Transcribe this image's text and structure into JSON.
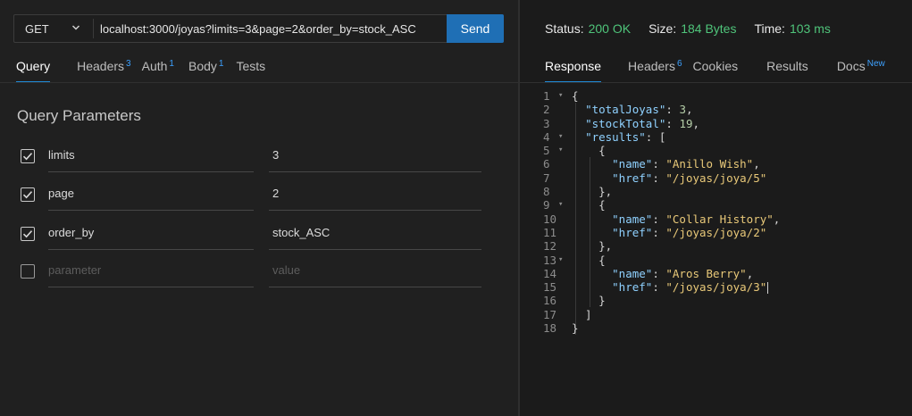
{
  "request": {
    "method": "GET",
    "url": "localhost:3000/joyas?limits=3&page=2&order_by=stock_ASC",
    "send_label": "Send"
  },
  "request_tabs": [
    {
      "label": "Query",
      "badge": ""
    },
    {
      "label": "Headers",
      "badge": "3"
    },
    {
      "label": "Auth",
      "badge": "1"
    },
    {
      "label": "Body",
      "badge": "1"
    },
    {
      "label": "Tests",
      "badge": ""
    }
  ],
  "query": {
    "title": "Query Parameters",
    "params": [
      {
        "key": "limits",
        "value": "3",
        "checked": true
      },
      {
        "key": "page",
        "value": "2",
        "checked": true
      },
      {
        "key": "order_by",
        "value": "stock_ASC",
        "checked": true
      }
    ],
    "new_param": {
      "key_placeholder": "parameter",
      "value_placeholder": "value"
    }
  },
  "status": {
    "status_label": "Status:",
    "status_value": "200 OK",
    "size_label": "Size:",
    "size_value": "184 Bytes",
    "time_label": "Time:",
    "time_value": "103 ms"
  },
  "response_tabs": [
    {
      "label": "Response",
      "badge": ""
    },
    {
      "label": "Headers",
      "badge": "6"
    },
    {
      "label": "Cookies",
      "badge": ""
    },
    {
      "label": "Results",
      "badge": ""
    },
    {
      "label": "Docs",
      "badge": "New"
    }
  ],
  "response_lines": [
    {
      "n": "1",
      "fold": true,
      "tokens": [
        [
          "p",
          "{"
        ]
      ]
    },
    {
      "n": "2",
      "fold": false,
      "tokens": [
        [
          "p",
          "  "
        ],
        [
          "key",
          "\"totalJoyas\""
        ],
        [
          "p",
          ": "
        ],
        [
          "num",
          "3"
        ],
        [
          "p",
          ","
        ]
      ]
    },
    {
      "n": "3",
      "fold": false,
      "tokens": [
        [
          "p",
          "  "
        ],
        [
          "key",
          "\"stockTotal\""
        ],
        [
          "p",
          ": "
        ],
        [
          "num",
          "19"
        ],
        [
          "p",
          ","
        ]
      ]
    },
    {
      "n": "4",
      "fold": true,
      "tokens": [
        [
          "p",
          "  "
        ],
        [
          "key",
          "\"results\""
        ],
        [
          "p",
          ": ["
        ]
      ]
    },
    {
      "n": "5",
      "fold": true,
      "tokens": [
        [
          "p",
          "    {"
        ]
      ]
    },
    {
      "n": "6",
      "fold": false,
      "tokens": [
        [
          "p",
          "      "
        ],
        [
          "key",
          "\"name\""
        ],
        [
          "p",
          ": "
        ],
        [
          "str",
          "\"Anillo Wish\""
        ],
        [
          "p",
          ","
        ]
      ]
    },
    {
      "n": "7",
      "fold": false,
      "tokens": [
        [
          "p",
          "      "
        ],
        [
          "key",
          "\"href\""
        ],
        [
          "p",
          ": "
        ],
        [
          "str",
          "\"/joyas/joya/5\""
        ]
      ]
    },
    {
      "n": "8",
      "fold": false,
      "tokens": [
        [
          "p",
          "    },"
        ]
      ]
    },
    {
      "n": "9",
      "fold": true,
      "tokens": [
        [
          "p",
          "    {"
        ]
      ]
    },
    {
      "n": "10",
      "fold": false,
      "tokens": [
        [
          "p",
          "      "
        ],
        [
          "key",
          "\"name\""
        ],
        [
          "p",
          ": "
        ],
        [
          "str",
          "\"Collar History\""
        ],
        [
          "p",
          ","
        ]
      ]
    },
    {
      "n": "11",
      "fold": false,
      "tokens": [
        [
          "p",
          "      "
        ],
        [
          "key",
          "\"href\""
        ],
        [
          "p",
          ": "
        ],
        [
          "str",
          "\"/joyas/joya/2\""
        ]
      ]
    },
    {
      "n": "12",
      "fold": false,
      "tokens": [
        [
          "p",
          "    },"
        ]
      ]
    },
    {
      "n": "13",
      "fold": true,
      "tokens": [
        [
          "p",
          "    {"
        ]
      ]
    },
    {
      "n": "14",
      "fold": false,
      "tokens": [
        [
          "p",
          "      "
        ],
        [
          "key",
          "\"name\""
        ],
        [
          "p",
          ": "
        ],
        [
          "str",
          "\"Aros Berry\""
        ],
        [
          "p",
          ","
        ]
      ]
    },
    {
      "n": "15",
      "fold": false,
      "tokens": [
        [
          "p",
          "      "
        ],
        [
          "key",
          "\"href\""
        ],
        [
          "p",
          ": "
        ],
        [
          "str",
          "\"/joyas/joya/3\""
        ]
      ]
    },
    {
      "n": "16",
      "fold": false,
      "tokens": [
        [
          "p",
          "    }"
        ]
      ]
    },
    {
      "n": "17",
      "fold": false,
      "tokens": [
        [
          "p",
          "  ]"
        ]
      ]
    },
    {
      "n": "18",
      "fold": false,
      "tokens": [
        [
          "p",
          "}"
        ]
      ]
    }
  ],
  "colors": {
    "accent": "#1f6fb5",
    "status_ok": "#4fc47a",
    "badge": "#3da1ff",
    "json_key": "#8fd1ff",
    "json_string": "#e9c979",
    "json_number": "#b5cea8"
  }
}
